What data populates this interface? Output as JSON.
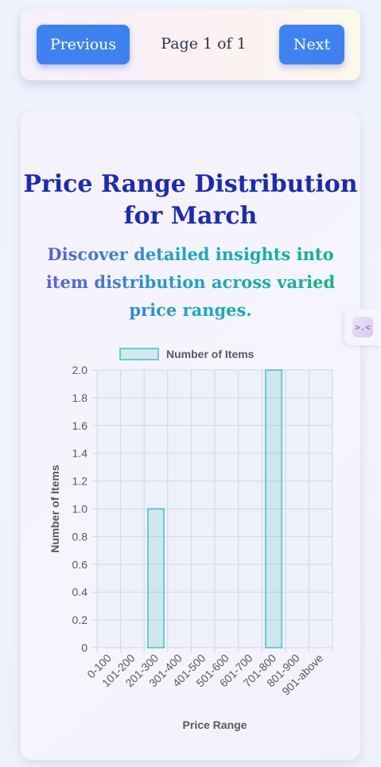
{
  "pagination": {
    "previous_label": "Previous",
    "page_label": "Page 1 of 1",
    "next_label": "Next"
  },
  "card": {
    "title": "Price Range Distribution for March",
    "subtitle": "Discover detailed insights into item distribution across varied price ranges."
  },
  "side_tab": {
    "icon": "collapse-icon",
    "glyph": ">.<"
  },
  "colors": {
    "button": "#3e82f1",
    "title": "#1b2bb5",
    "bar_fill": "rgba(75, 192, 192, 0.2)",
    "bar_border": "#4bc0c0"
  },
  "chart_data": {
    "type": "bar",
    "legend": "Number of Items",
    "legend_position": "top",
    "categories": [
      "0-100",
      "101-200",
      "201-300",
      "301-400",
      "401-500",
      "501-600",
      "601-700",
      "701-800",
      "801-900",
      "901-above"
    ],
    "series": [
      {
        "name": "Number of Items",
        "values": [
          0,
          0,
          1,
          0,
          0,
          0,
          0,
          2,
          0,
          0
        ]
      }
    ],
    "xlabel": "Price Range",
    "ylabel": "Number of Items",
    "ylim": [
      0,
      2
    ],
    "yticks": [
      "0",
      "0.2",
      "0.4",
      "0.6",
      "0.8",
      "1.0",
      "1.2",
      "1.4",
      "1.6",
      "1.8",
      "2.0"
    ],
    "grid": true
  }
}
